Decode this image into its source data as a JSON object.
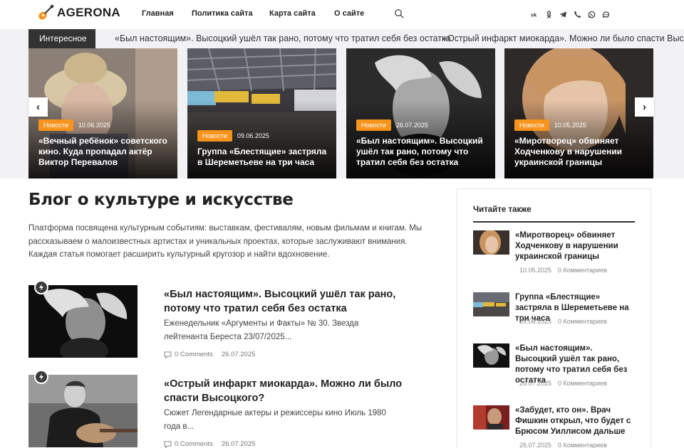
{
  "header": {
    "logo": "AGERONA",
    "nav": [
      "Главная",
      "Политика сайта",
      "Карта сайта",
      "О сайте"
    ],
    "socials": [
      "vk-icon",
      "odnoklassniki-icon",
      "telegram-icon",
      "viber-icon",
      "whatsapp-icon",
      "max-icon"
    ]
  },
  "ticker": {
    "label": "Интересное",
    "items": [
      "«Был настоящим». Высоцкий ушёл так рано, потому что тратил себя без остатка",
      "«Острый инфаркт миокарда». Можно ли было спасти Высоцкого?"
    ]
  },
  "slider": {
    "prev": "‹",
    "next": "›",
    "cards": [
      {
        "category": "Новости",
        "date": "10.06.2025",
        "title": "«Вечный ребёнок» советского кино. Куда пропадал актёр Виктор Перевалов"
      },
      {
        "category": "Новости",
        "date": "09.06.2025",
        "title": "Группа «Блестящие» застряла в Шереметьеве на три часа"
      },
      {
        "category": "Новости",
        "date": "26.07.2025",
        "title": "«Был настоящим». Высоцкий ушёл так рано, потому что тратил себя без остатка"
      },
      {
        "category": "Новости",
        "date": "10.05.2025",
        "title": "«Миротворец» обвиняет Ходченкову в нарушении украинской границы"
      }
    ]
  },
  "main": {
    "title": "Блог о культуре и искусстве",
    "intro": "Платформа посвящена культурным событиям: выставкам, фестивалям, новым фильмам и книгам. Мы рассказываем о малоизвестных артистах и уникальных проектах, которые заслуживают внимания. Каждая статья помогает расширить культурный кругозор и найти вдохновение.",
    "posts": [
      {
        "title": "«Был настоящим». Высоцкий ушёл так рано, потому что тратил себя без остатка",
        "excerpt": "Еженедельник «Аргументы и Факты» № 30. Звезда лейтенанта Береста 23/07/2025...",
        "comments": "0 Comments",
        "date": "26.07.2025"
      },
      {
        "title": "«Острый инфаркт миокарда». Можно ли было спасти Высоцкого?",
        "excerpt": "Сюжет Легендарные актеры и режиссеры кино Июль 1980 года в...",
        "comments": "0 Comments",
        "date": "26.07.2025"
      }
    ]
  },
  "sidebar": {
    "title": "Читайте также",
    "items": [
      {
        "title": "«Миротворец» обвиняет Ходченкову в нарушении украинской границы",
        "date": "10.05.2025",
        "comments": "0 Комментариев"
      },
      {
        "title": "Группа «Блестящие» застряла в Шереметьеве на три часа",
        "date": "09.06.2025",
        "comments": "0 Комментариев"
      },
      {
        "title": "«Был настоящим». Высоцкий ушёл так рано, потому что тратил себя без остатка",
        "date": "26.07.2025",
        "comments": "0 Комментариев"
      },
      {
        "title": "«Забудет, кто он». Врач Фишкин открыл, что будет с Брюсом Уиллисом дальше",
        "date": "26.07.2025",
        "comments": "0 Комментариев"
      }
    ]
  },
  "colors": {
    "accent": "#f7941d",
    "dark": "#333333",
    "ticker_bg": "#f2f2f5"
  }
}
